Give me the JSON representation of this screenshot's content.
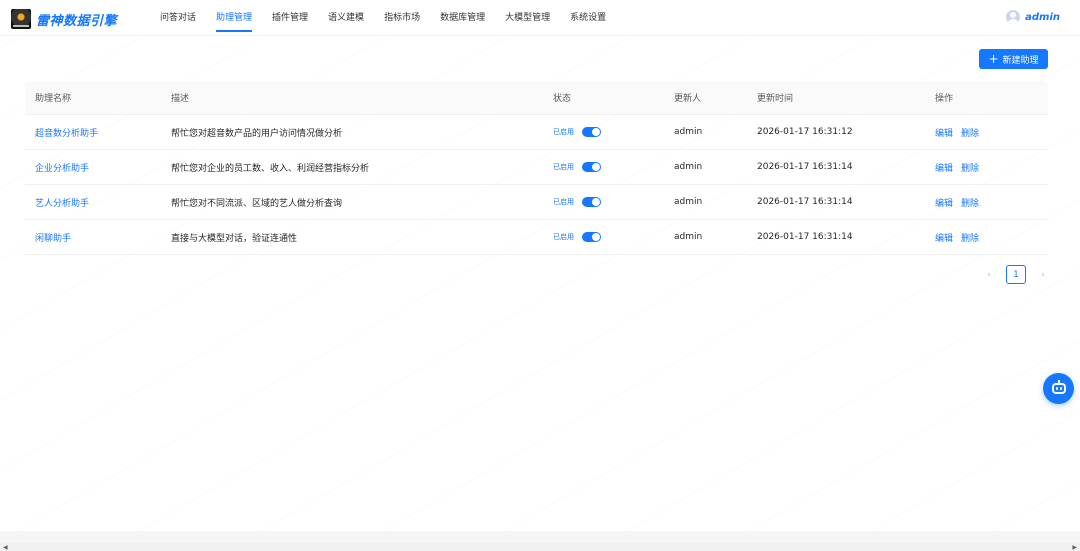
{
  "header": {
    "brand": "雷神数据引擎",
    "nav": [
      "问答对话",
      "助理管理",
      "插件管理",
      "语义建模",
      "指标市场",
      "数据库管理",
      "大模型管理",
      "系统设置"
    ],
    "active_nav": "助理管理",
    "username": "admin"
  },
  "toolbar": {
    "new_label": "新建助理",
    "new_icon": "plus-icon"
  },
  "table": {
    "columns": [
      "助理名称",
      "描述",
      "状态",
      "更新人",
      "更新时间",
      "操作"
    ],
    "rows": [
      {
        "name": "超音数分析助手",
        "desc": "帮忙您对超音数产品的用户访问情况做分析",
        "status": "已启用",
        "updater": "admin",
        "time": "2026-01-17 16:31:12",
        "edit": "编辑",
        "delete": "删除"
      },
      {
        "name": "企业分析助手",
        "desc": "帮忙您对企业的员工数、收入、利润经营指标分析",
        "status": "已启用",
        "updater": "admin",
        "time": "2026-01-17 16:31:14",
        "edit": "编辑",
        "delete": "删除"
      },
      {
        "name": "艺人分析助手",
        "desc": "帮忙您对不同流派、区域的艺人做分析查询",
        "status": "已启用",
        "updater": "admin",
        "time": "2026-01-17 16:31:14",
        "edit": "编辑",
        "delete": "删除"
      },
      {
        "name": "闲聊助手",
        "desc": "直接与大模型对话，验证连通性",
        "status": "已启用",
        "updater": "admin",
        "time": "2026-01-17 16:31:14",
        "edit": "编辑",
        "delete": "删除"
      }
    ]
  },
  "pagination": {
    "current": "1",
    "prev_icon": "chevron-left-icon",
    "next_icon": "chevron-right-icon"
  },
  "colors": {
    "primary": "#1677ff"
  }
}
